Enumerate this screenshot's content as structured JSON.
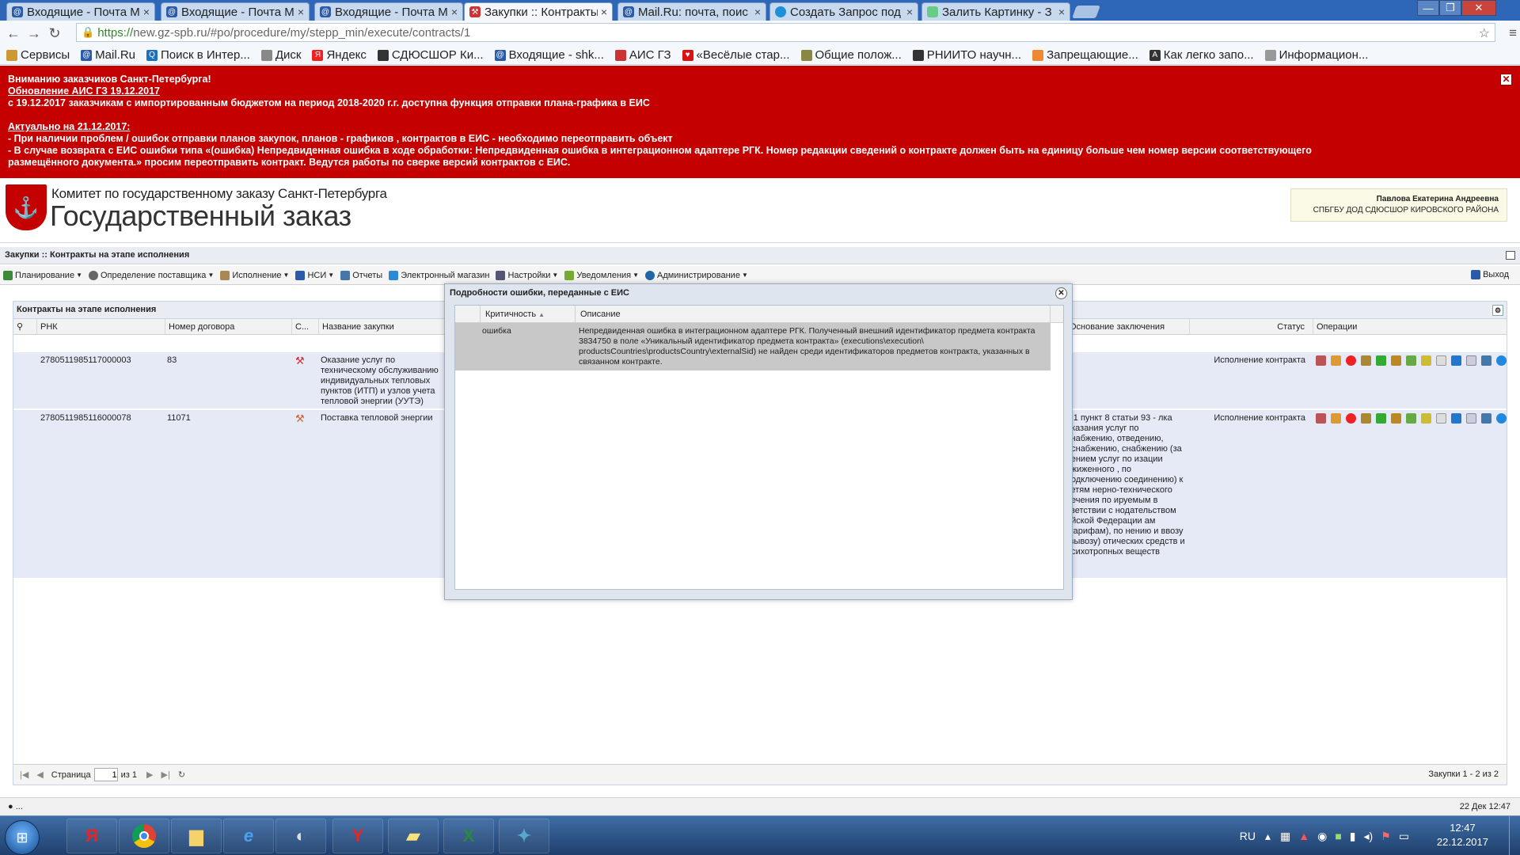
{
  "browser": {
    "tabs": [
      {
        "label": "Входящие - Почта M",
        "color": "#2a5aa8"
      },
      {
        "label": "Входящие - Почта M",
        "color": "#2a5aa8"
      },
      {
        "label": "Входящие - Почта M",
        "color": "#2a5aa8"
      },
      {
        "label": "Закупки :: Контракты",
        "color": "#c33"
      },
      {
        "label": "Mail.Ru: почта, поис",
        "color": "#2a5aa8"
      },
      {
        "label": "Создать Запрос под",
        "color": "#1e90d8"
      },
      {
        "label": "Залить Картинку - З",
        "color": "#6c8"
      }
    ],
    "url_scheme": "https://",
    "url_rest": "new.gz-spb.ru/#po/procedure/my/stepp_min/execute/contracts/1",
    "bookmarks": [
      {
        "label": "Сервисы",
        "color": "#c93"
      },
      {
        "label": "Mail.Ru",
        "color": "#2a5aa8"
      },
      {
        "label": "Поиск в Интер...",
        "color": "#1d6fc2"
      },
      {
        "label": "Диск",
        "color": "#888"
      },
      {
        "label": "Яндекс",
        "color": "#e22"
      },
      {
        "label": "СДЮСШОР Ки...",
        "color": "#333"
      },
      {
        "label": "Входящие - shk...",
        "color": "#2a5aa8"
      },
      {
        "label": "АИС ГЗ",
        "color": "#c33"
      },
      {
        "label": "«Весёлые стар...",
        "color": "#d11"
      },
      {
        "label": "Общие полож...",
        "color": "#884"
      },
      {
        "label": "РНИИТО научн...",
        "color": "#333"
      },
      {
        "label": "Запрещающие...",
        "color": "#e83"
      },
      {
        "label": "Как легко запо...",
        "color": "#333"
      },
      {
        "label": "Информацион...",
        "color": "#999"
      }
    ]
  },
  "banner": {
    "line1": "Вниманию заказчиков Санкт-Петербурга!",
    "line2": "Обновление АИС ГЗ 19.12.2017",
    "line3": "с 19.12.2017 заказчикам с импортированным бюджетом на период 2018-2020 г.г.  доступна функция отправки плана-графика  в ЕИС",
    "line4": "Актуально на 21.12.2017:",
    "line5": "- При наличии проблем / ошибок отправки планов закупок, планов - графиков , контрактов в ЕИС - необходимо переотправить объект",
    "line6": "- В случае возврата с ЕИС ошибки типа «(ошибка) Непредвиденная ошибка в ходе обработки: Непредвиденная ошибка в интеграционном адаптере РГК. Номер редакции сведений о контракте должен быть на единицу больше чем номер версии соответствующего",
    "line7": "размещённого документа.» просим переотправить контракт. Ведутся работы по сверке версий контрактов с ЕИС."
  },
  "header": {
    "org": "Комитет по государственному заказу Санкт-Петербурга",
    "title": "Государственный заказ",
    "user_name": "Павлова Екатерина Андреевна",
    "user_org": "СПБГБУ ДОД СДЮСШОР КИРОВСКОГО РАЙОНА"
  },
  "breadcrumb": "Закупки :: Контракты на этапе исполнения",
  "menu": [
    {
      "label": "Планирование",
      "color": "#3a8a3a",
      "caret": true
    },
    {
      "label": "Определение поставщика",
      "color": "#666",
      "caret": true
    },
    {
      "label": "Исполнение",
      "color": "#a85",
      "caret": true
    },
    {
      "label": "НСИ",
      "color": "#2a5aa8",
      "caret": true
    },
    {
      "label": "Отчеты",
      "color": "#4477aa",
      "caret": false
    },
    {
      "label": "Электронный магазин",
      "color": "#2a8ad8",
      "caret": false
    },
    {
      "label": "Настройки",
      "color": "#557",
      "caret": true
    },
    {
      "label": "Уведомления",
      "color": "#7a3",
      "caret": true
    },
    {
      "label": "Администрирование",
      "color": "#26a",
      "caret": true
    }
  ],
  "exit_label": "Выход",
  "grid": {
    "title": "Контракты на этапе исполнения",
    "headers": {
      "rnk": "РНК",
      "contract_no": "Номер договора",
      "c": "С...",
      "name": "Название закупки",
      "basis": "Основание заключения",
      "status": "Статус",
      "ops": "Операции"
    },
    "rows": [
      {
        "rnk": "2780511985117000003",
        "contract_no": "83",
        "name": "Оказание услуг по техническому обслуживанию индивидуальных тепловых пунктов (ИТП) и узлов учета тепловой энергии (УУТЭ)",
        "basis": "",
        "status": "Исполнение контракта"
      },
      {
        "rnk": "2780511985116000078",
        "contract_no": "11071",
        "name": "Поставка тепловой энергии",
        "basis": "ь 1 пункт 8 статьи 93 - лка оказания услуг по снабжению, отведению, оснабжению, снабжению (за чением услуг по изации сжиженного , по подключению соединению) к сетям нерно-технического печения по ируемым в тветствии с нодательством ийской Федерации ам (тарифам), по нению и ввозу (вывозу) отических средств и нсихотропных веществ",
        "status": "Исполнение контракта"
      }
    ],
    "pager": {
      "page_label": "Страница",
      "page_value": "1",
      "of_label": "из 1",
      "info": "Закупки 1 - 2 из 2"
    }
  },
  "modal": {
    "title": "Подробности ошибки, переданные с ЕИС",
    "col_severity": "Критичность",
    "col_description": "Описание",
    "severity": "ошибка",
    "description": "Непредвиденная ошибка в интеграционном адаптере РГК. Полученный внешний идентификатор предмета контракта 3834750 в поле «Уникальный идентификатор предмета контракта» (executions\\execution\\ productsCountries\\productsCountry\\externalSid) не найден среди идентификаторов предметов контракта, указанных в связанном контракте."
  },
  "statusbar": {
    "left": "...",
    "right": "22 Дек 12:47"
  },
  "taskbar": {
    "lang": "RU",
    "time": "12:47",
    "date": "22.12.2017"
  },
  "colors": {
    "banner": "#c40000",
    "row_bg": "#e6e9f6",
    "modal_row": "#c8c8c8"
  }
}
